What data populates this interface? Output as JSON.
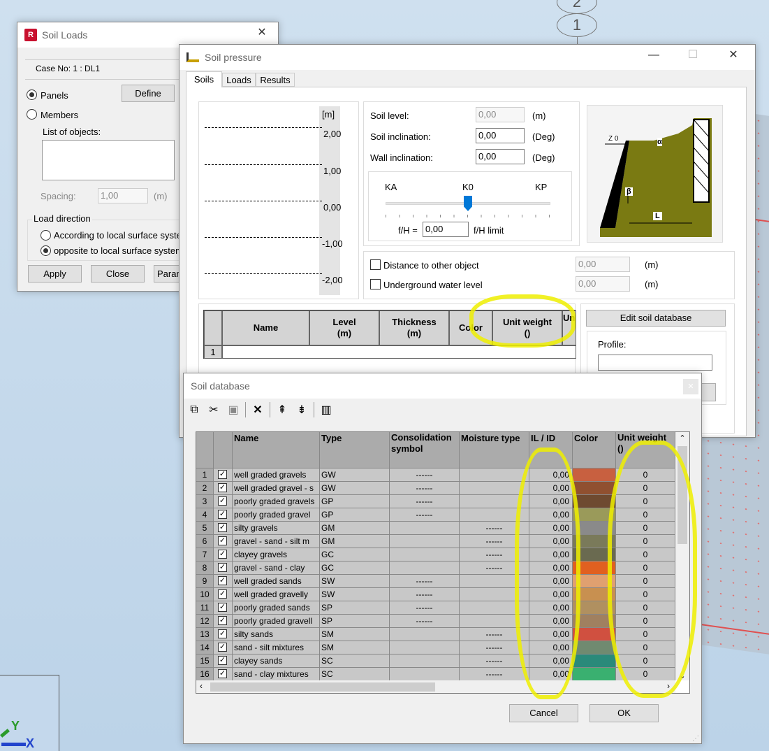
{
  "bg_axis": [
    "2",
    "1"
  ],
  "soil_loads": {
    "title": "Soil Loads",
    "case": "Case No: 1 : DL1",
    "panels": "Panels",
    "members": "Members",
    "define": "Define",
    "list_label": "List of objects:",
    "spacing_label": "Spacing:",
    "spacing_value": "1,00",
    "spacing_unit": "(m)",
    "load_direction": "Load direction",
    "opt1": "According to local surface system",
    "opt2": "opposite to local surface system",
    "apply": "Apply",
    "close": "Close",
    "params": "Parameters"
  },
  "soil_pressure": {
    "title": "Soil pressure",
    "tabs": [
      "Soils",
      "Loads",
      "Results"
    ],
    "scale_unit": "[m]",
    "scale": [
      "2,00",
      "1,00",
      "0,00",
      "-1,00",
      "-2,00"
    ],
    "soil_level": "Soil level:",
    "soil_level_val": "0,00",
    "soil_incl": "Soil inclination:",
    "soil_incl_val": "0,00",
    "wall_incl": "Wall inclination:",
    "wall_incl_val": "0,00",
    "unit_m": "(m)",
    "unit_deg": "(Deg)",
    "ka": "KA",
    "k0": "K0",
    "kp": "KP",
    "fh": "f/H =",
    "fh_val": "0,00",
    "fh_limit": "f/H limit",
    "dist": "Distance to other object",
    "dist_val": "0,00",
    "water": "Underground water level",
    "water_val": "0,00",
    "cols": [
      "Name",
      "Level\n(m)",
      "Thickness\n(m)",
      "Color",
      "Unit weight\n()",
      "Un"
    ],
    "row_num": "1",
    "edit_db": "Edit soil database",
    "profile": "Profile:",
    "diagram": {
      "z0": "Z 0",
      "alpha": "α",
      "beta": "β",
      "L": "L"
    }
  },
  "soil_db": {
    "title": "Soil database",
    "cols": [
      "Name",
      "Type",
      "Consolidation\nsymbol",
      "Moisture type",
      "IL / ID",
      "Color",
      "Unit weight\n()"
    ],
    "rows": [
      {
        "n": "1",
        "name": "well graded gravels",
        "type": "GW",
        "cons": "------",
        "moist": "",
        "il": "0,00",
        "color": "#c86040",
        "uw": "0"
      },
      {
        "n": "2",
        "name": "well graded gravel - s",
        "type": "GW",
        "cons": "------",
        "moist": "",
        "il": "0,00",
        "color": "#905030",
        "uw": "0"
      },
      {
        "n": "3",
        "name": "poorly graded gravels",
        "type": "GP",
        "cons": "------",
        "moist": "",
        "il": "0,00",
        "color": "#6e4a30",
        "uw": "0"
      },
      {
        "n": "4",
        "name": "poorly graded gravel",
        "type": "GP",
        "cons": "------",
        "moist": "",
        "il": "0,00",
        "color": "#9a9a5a",
        "uw": "0"
      },
      {
        "n": "5",
        "name": "silty gravels",
        "type": "GM",
        "cons": "",
        "moist": "------",
        "il": "0,00",
        "color": "#8a8a8a",
        "uw": "0"
      },
      {
        "n": "6",
        "name": "gravel - sand - silt  m",
        "type": "GM",
        "cons": "",
        "moist": "------",
        "il": "0,00",
        "color": "#7a7a5a",
        "uw": "0"
      },
      {
        "n": "7",
        "name": "clayey gravels",
        "type": "GC",
        "cons": "",
        "moist": "------",
        "il": "0,00",
        "color": "#6a6a50",
        "uw": "0"
      },
      {
        "n": "8",
        "name": "gravel - sand - clay",
        "type": "GC",
        "cons": "",
        "moist": "------",
        "il": "0,00",
        "color": "#e06020",
        "uw": "0"
      },
      {
        "n": "9",
        "name": "well graded sands",
        "type": "SW",
        "cons": "------",
        "moist": "",
        "il": "0,00",
        "color": "#e0a070",
        "uw": "0"
      },
      {
        "n": "10",
        "name": "well graded gravelly",
        "type": "SW",
        "cons": "------",
        "moist": "",
        "il": "0,00",
        "color": "#c89050",
        "uw": "0"
      },
      {
        "n": "11",
        "name": "poorly graded sands",
        "type": "SP",
        "cons": "------",
        "moist": "",
        "il": "0,00",
        "color": "#b09060",
        "uw": "0"
      },
      {
        "n": "12",
        "name": "poorly graded gravell",
        "type": "SP",
        "cons": "------",
        "moist": "",
        "il": "0,00",
        "color": "#a08060",
        "uw": "0"
      },
      {
        "n": "13",
        "name": "silty sands",
        "type": "SM",
        "cons": "",
        "moist": "------",
        "il": "0,00",
        "color": "#d05040",
        "uw": "0"
      },
      {
        "n": "14",
        "name": "sand - silt mixtures",
        "type": "SM",
        "cons": "",
        "moist": "------",
        "il": "0,00",
        "color": "#708a70",
        "uw": "0"
      },
      {
        "n": "15",
        "name": "clayey sands",
        "type": "SC",
        "cons": "",
        "moist": "------",
        "il": "0,00",
        "color": "#2a8a7a",
        "uw": "0"
      },
      {
        "n": "16",
        "name": "sand - clay mixtures",
        "type": "SC",
        "cons": "",
        "moist": "------",
        "il": "0,00",
        "color": "#3ab070",
        "uw": "0"
      }
    ],
    "cancel": "Cancel",
    "ok": "OK"
  },
  "axes": {
    "y": "Y",
    "x": "X"
  }
}
